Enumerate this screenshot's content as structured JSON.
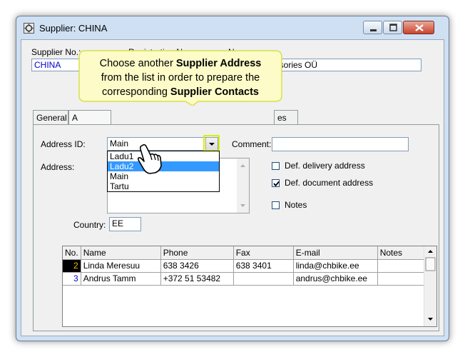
{
  "window": {
    "title": "Supplier: CHINA"
  },
  "fields": {
    "supplier_no_label": "Supplier No.:",
    "supplier_no_value": "CHINA",
    "registration_label": "Registration No.:",
    "name_label": "Name:",
    "name_value_visible": "essories OÜ"
  },
  "tabs": [
    {
      "label": "General",
      "active": false
    },
    {
      "label": "A",
      "active": true
    },
    {
      "label": "es",
      "active": false
    }
  ],
  "address": {
    "id_label": "Address ID:",
    "id_value": "Main",
    "comment_label": "Comment:",
    "comment_value": "",
    "address_label": "Address:",
    "options": [
      "Ladu1",
      "Ladu2",
      "Main",
      "Tartu"
    ],
    "selected_option_index": 1,
    "def_delivery_label": "Def. delivery address",
    "def_delivery_checked": false,
    "def_document_label": "Def. document address",
    "def_document_checked": true,
    "notes_label": "Notes",
    "notes_checked": false,
    "country_label": "Country:",
    "country_value": "EE"
  },
  "contacts": {
    "columns": [
      "No.",
      "Name",
      "Phone",
      "Fax",
      "E-mail",
      "Notes"
    ],
    "rows": [
      {
        "no": "2",
        "name": "Linda Meresuu",
        "phone": "638 3426",
        "fax": "638 3401",
        "email": "linda@chbike.ee",
        "notes": ""
      },
      {
        "no": "3",
        "name": "Andrus Tamm",
        "phone": "+372 51 53482",
        "fax": "",
        "email": "andrus@chbike.ee",
        "notes": ""
      }
    ]
  },
  "callout": {
    "line1_pre": "Choose another ",
    "line1_bold": "Supplier Address",
    "line2": "from the list in order to prepare the",
    "line3_pre": "corresponding ",
    "line3_bold": "Supplier Contacts"
  },
  "icons": {
    "app": "supplier-app-icon",
    "minimize": "minimize-icon",
    "maximize": "maximize-icon",
    "close": "close-icon",
    "dropdown": "chevron-down-icon",
    "cursor": "hand-pointer-icon"
  },
  "colors": {
    "highlight": "#d8f000",
    "callout_fill": "#fdfbc8",
    "selection": "#3399ff",
    "link_blue": "#0000cc"
  }
}
